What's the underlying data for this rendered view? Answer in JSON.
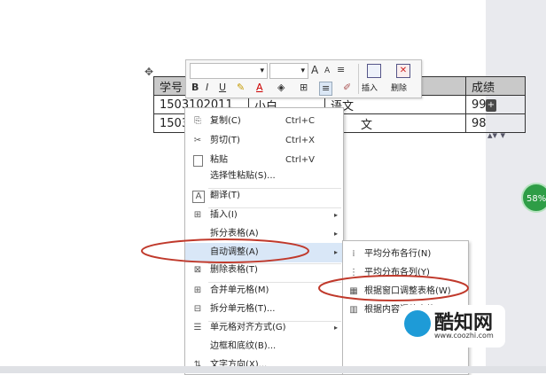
{
  "table": {
    "header": [
      "学号",
      "",
      "",
      "成绩"
    ],
    "rows": [
      [
        "1503102011",
        "小白",
        "语文",
        "99"
      ],
      [
        "1503",
        "",
        "",
        "98"
      ]
    ],
    "row3_partial": "文"
  },
  "side": {
    "row_add": "+",
    "widget": "▴▾ ▾",
    "zoom_badge": "58%"
  },
  "toolbar": {
    "font_dropdown": "▾",
    "size_dropdown": "▾",
    "grow": "A",
    "shrink": "A",
    "list": "≡",
    "bold": "B",
    "italic": "I",
    "underline": "U",
    "highlight": "✎",
    "font_color": "A",
    "shading": "◈",
    "borders": "⊞",
    "align": "≡",
    "format_painter": "✐",
    "insert_label": "插入",
    "delete_label": "删除"
  },
  "menu": {
    "items": [
      {
        "icon": "copy-icon",
        "glyph": "⎘",
        "label": "复制(C)",
        "shortcut": "Ctrl+C"
      },
      {
        "icon": "cut-icon",
        "glyph": "✂",
        "label": "剪切(T)",
        "shortcut": "Ctrl+X"
      },
      {
        "icon": "paste-icon",
        "glyph": "📋",
        "label": "粘贴",
        "shortcut": "Ctrl+V"
      },
      {
        "icon": "",
        "glyph": "",
        "label": "选择性粘贴(S)...",
        "shortcut": ""
      },
      {
        "icon": "translate-icon",
        "glyph": "A",
        "label": "翻译(T)",
        "shortcut": ""
      },
      {
        "icon": "insert-icon",
        "glyph": "⊞",
        "label": "插入(I)",
        "arrow": "▸"
      },
      {
        "icon": "",
        "glyph": "",
        "label": "拆分表格(A)",
        "arrow": "▸"
      },
      {
        "icon": "",
        "glyph": "",
        "label": "自动调整(A)",
        "arrow": "▸"
      },
      {
        "icon": "delete-table-icon",
        "glyph": "⊠",
        "label": "删除表格(T)"
      },
      {
        "icon": "merge-cells-icon",
        "glyph": "⊞",
        "label": "合并单元格(M)"
      },
      {
        "icon": "split-cells-icon",
        "glyph": "⊟",
        "label": "拆分单元格(T)..."
      },
      {
        "icon": "cell-align-icon",
        "glyph": "☰",
        "label": "单元格对齐方式(G)",
        "arrow": "▸"
      },
      {
        "icon": "",
        "glyph": "",
        "label": "边框和底纹(B)..."
      },
      {
        "icon": "text-direction-icon",
        "glyph": "⇅",
        "label": "文字方向(X)..."
      }
    ]
  },
  "submenu": {
    "items": [
      {
        "icon": "distribute-rows-icon",
        "label": "平均分布各行(N)"
      },
      {
        "icon": "distribute-cols-icon",
        "label": "平均分布各列(Y)"
      },
      {
        "icon": "fit-window-icon",
        "label": "根据窗口调整表格(W)"
      },
      {
        "icon": "fit-content-icon",
        "label": "根据内容调整表格(F)"
      }
    ]
  },
  "watermark": {
    "name": "酷知网",
    "url": "www.coozhi.com"
  },
  "colors": {
    "menu_highlight": "#d9e7f7",
    "annotation": "#c0392b",
    "header_fill": "#c9c9c9",
    "badge": "#2e9d46"
  }
}
